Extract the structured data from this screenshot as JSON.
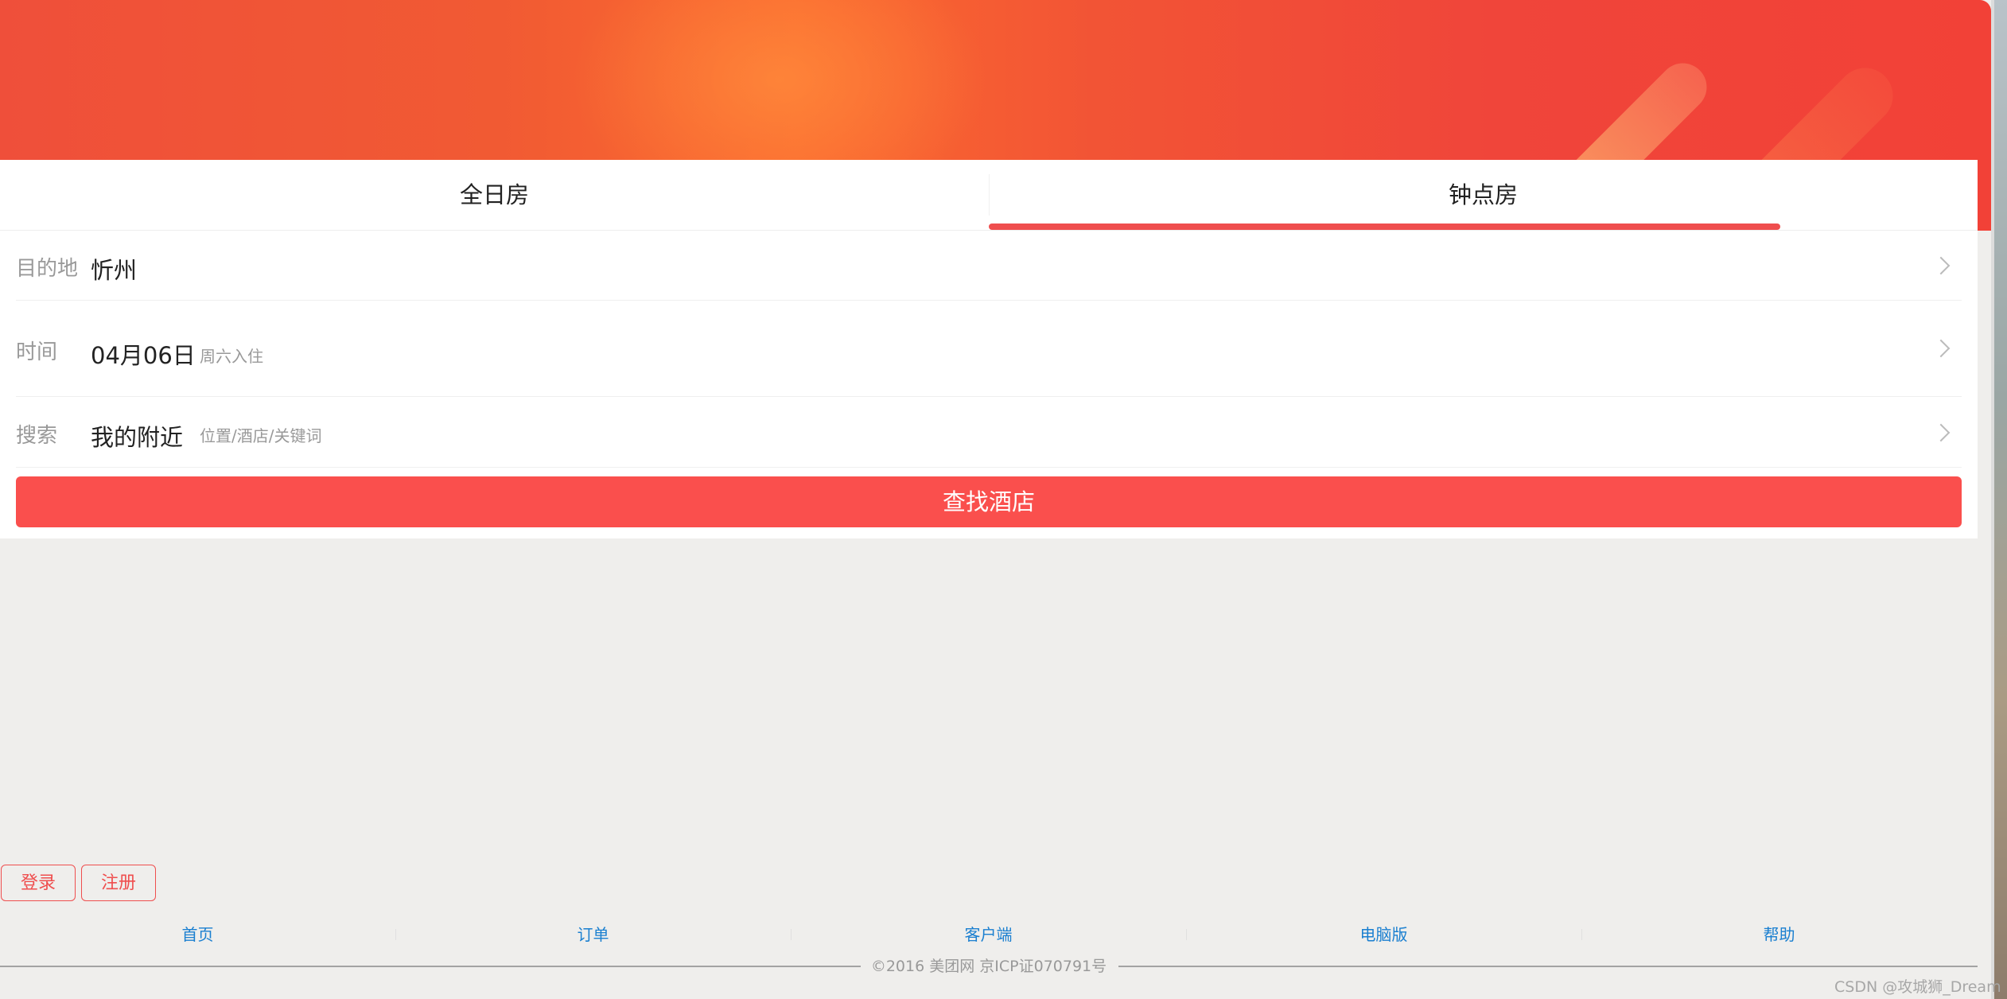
{
  "tabs": [
    {
      "label": "全日房"
    },
    {
      "label": "钟点房",
      "active": true
    }
  ],
  "form": {
    "destination": {
      "label": "目的地",
      "value": "忻州"
    },
    "time": {
      "label": "时间",
      "value": "04月06日",
      "hint": "周六入住"
    },
    "search": {
      "label": "搜索",
      "value": "我的附近",
      "hint": "位置/酒店/关键词"
    }
  },
  "submit_label": "查找酒店",
  "auth": {
    "login": "登录",
    "register": "注册"
  },
  "footer": {
    "nav": [
      "首页",
      "订单",
      "客户端",
      "电脑版",
      "帮助"
    ],
    "copyright": "©2016 美团网 京ICP证070791号"
  },
  "watermark": "CSDN @攻城狮_Dream",
  "colors": {
    "accent": "#ef4e4e",
    "button": "#fa4f4d",
    "link": "#1a7fd0",
    "background": "#efeeec"
  },
  "icons": {
    "row_arrow": "chevron-right-icon"
  }
}
